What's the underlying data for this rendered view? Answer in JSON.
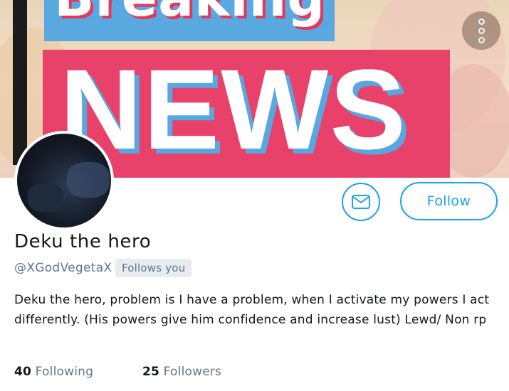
{
  "banner": {
    "breaking_text": "Breaking",
    "news_text": "NEWS",
    "colors": {
      "news_box": "#e8416a",
      "breaking_box": "#5aa8e0",
      "accent": "#1da1f2"
    }
  },
  "icons": {
    "menu": "more-vertical-icon",
    "message": "envelope-icon"
  },
  "actions": {
    "follow_label": "Follow"
  },
  "profile": {
    "display_name": "Deku the hero",
    "handle": "@XGodVegetaX",
    "follows_you": "Follows you",
    "bio": "Deku the hero, problem is I have a problem, when I activate my powers I act differently. (His powers give him confidence and increase lust) Lewd/ Non rp"
  },
  "stats": {
    "following_count": "40",
    "following_label": "Following",
    "followers_count": "25",
    "followers_label": "Followers"
  }
}
